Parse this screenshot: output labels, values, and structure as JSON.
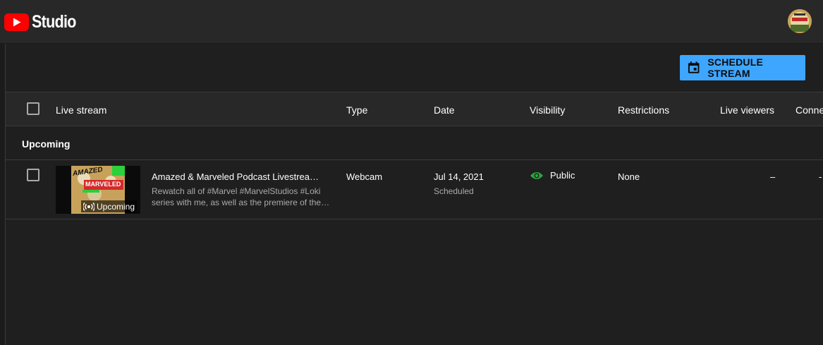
{
  "app": {
    "logo_text": "Studio",
    "logo_icon": "youtube-play-icon",
    "avatar_icon": "channel-avatar",
    "brand_color": "#ff0000"
  },
  "toolbar": {
    "schedule_label": "SCHEDULE STREAM",
    "schedule_icon": "calendar-icon",
    "accent_color": "#3ea6ff"
  },
  "table": {
    "columns": {
      "live_stream": "Live stream",
      "type": "Type",
      "date": "Date",
      "visibility": "Visibility",
      "restrictions": "Restrictions",
      "live_viewers": "Live viewers",
      "connections": "Conne"
    },
    "section": "Upcoming",
    "rows": [
      {
        "title": "Amazed & Marveled Podcast Livestrea…",
        "description": "Rewatch all of #Marvel #MarvelStudios #Loki series with me, as well as the premiere of the…",
        "thumbnail_badge": "Upcoming",
        "thumbnail_text_top": "AMAZED",
        "thumbnail_text_main": "MARVELED",
        "type": "Webcam",
        "date": "Jul 14, 2021",
        "date_status": "Scheduled",
        "visibility": "Public",
        "visibility_color": "#2ba640",
        "restrictions": "None",
        "live_viewers": "–",
        "connections": "-"
      }
    ]
  }
}
